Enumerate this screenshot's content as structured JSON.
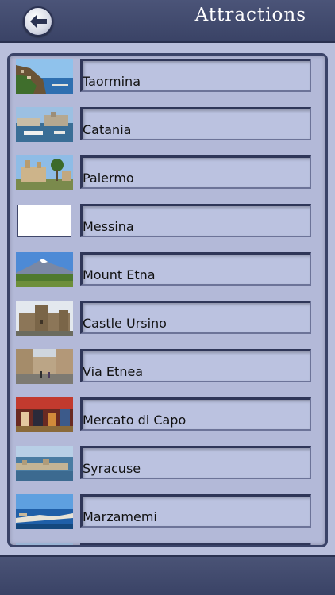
{
  "header": {
    "title": "Attractions",
    "back_icon": "arrow-left-icon"
  },
  "colors": {
    "bar": "#3f4870",
    "panel": "#b3b9d8",
    "label_box": "#bbc2e0"
  },
  "attractions": [
    {
      "name": "Taormina",
      "thumb": "coastal-town-photo"
    },
    {
      "name": "Catania",
      "thumb": "harbor-photo"
    },
    {
      "name": "Palermo",
      "thumb": "cathedral-photo"
    },
    {
      "name": "Messina",
      "thumb": "blank"
    },
    {
      "name": "Mount Etna",
      "thumb": "volcano-photo"
    },
    {
      "name": "Castle Ursino",
      "thumb": "castle-photo"
    },
    {
      "name": "Via Etnea",
      "thumb": "street-photo"
    },
    {
      "name": "Mercato di Capo",
      "thumb": "market-photo"
    },
    {
      "name": "Syracuse",
      "thumb": "island-photo"
    },
    {
      "name": "Marzamemi",
      "thumb": "harbor-panorama-photo"
    },
    {
      "name": "",
      "thumb": "partial-photo"
    }
  ]
}
